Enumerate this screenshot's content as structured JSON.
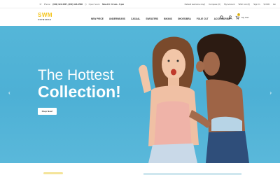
{
  "topbar": {
    "phone_label": "Phone:",
    "phone_numbers": "(000) 123-4567, (000) 123-4568",
    "hours_label": "Open hours:",
    "hours_value": "Mon-Fri: 10 am - 6 pm",
    "util": [
      "Default welcome msg!",
      "Compare (0)",
      "My Account",
      "Wish List (0)",
      "Sign In",
      "$ USD",
      "En"
    ]
  },
  "header": {
    "logo_main": "SWM",
    "logo_sub": "UNIWERAS",
    "nav": [
      "NEW PIECE",
      "UNDERWEARS",
      "CASUAL",
      "SWEATERS",
      "BIKINIS",
      "SHOES/BRA",
      "FOLIE CUT",
      "ACCESSORIES"
    ],
    "cart_count": "0",
    "cart_label": "My Cart"
  },
  "hero": {
    "title_line1": "The Hottest",
    "title_line2": "Collection!",
    "button_label": "Shop Now!",
    "prev_arrow": "‹",
    "next_arrow": "›"
  },
  "colors": {
    "accent": "#f4c51c",
    "hero_bg": "#4db0d5"
  },
  "icons": [
    "search-icon",
    "user-icon",
    "cart-icon",
    "phone-icon",
    "clock-icon"
  ]
}
